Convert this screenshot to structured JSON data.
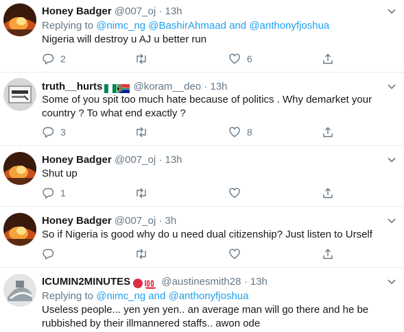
{
  "tweets": [
    {
      "name": "Honey Badger",
      "handle": "@007_oj",
      "sep": "·",
      "time": "13h",
      "replying_label": "Replying to",
      "replying": "@nimc_ng @BashirAhmaad and @anthonyfjoshua",
      "text": "Nigeria will destroy u AJ u better run",
      "replies": "2",
      "retweets": "",
      "likes": "6"
    },
    {
      "name": "truth__hurts",
      "flags": [
        "nigeria-flag-icon",
        "south-africa-flag-icon"
      ],
      "handle": "@koram__deo",
      "sep": "·",
      "time": "13h",
      "text": "Some of you spit too much hate because of politics . Why demarket your country ? To what end exactly ?",
      "replies": "3",
      "retweets": "",
      "likes": "8"
    },
    {
      "name": "Honey Badger",
      "handle": "@007_oj",
      "sep": "·",
      "time": "13h",
      "text": "Shut up",
      "replies": "1",
      "retweets": "",
      "likes": ""
    },
    {
      "name": "Honey Badger",
      "handle": "@007_oj",
      "sep": "·",
      "time": "3h",
      "text": "So if Nigeria is good why do u need dual citizenship? Just listen to Urself",
      "replies": "",
      "retweets": "",
      "likes": ""
    },
    {
      "name": "ICUMIN2MINUTES",
      "emoji": [
        "red-circle-icon",
        "hundred-points-icon"
      ],
      "handle": "@austinesmith28",
      "sep": "·",
      "time": "13h",
      "replying_label": "Replying to",
      "replying": "@nimc_ng and @anthonyfjoshua",
      "text": "Useless people... yen yen yen.. an average man will go there and he be rubbished by their illmannered staffs..  awon ode"
    }
  ],
  "colors": {
    "link": "#1da1f2",
    "muted": "#657786",
    "text": "#14171a",
    "divider": "#e6ecf0",
    "emoji_red": "#dd2e44"
  }
}
